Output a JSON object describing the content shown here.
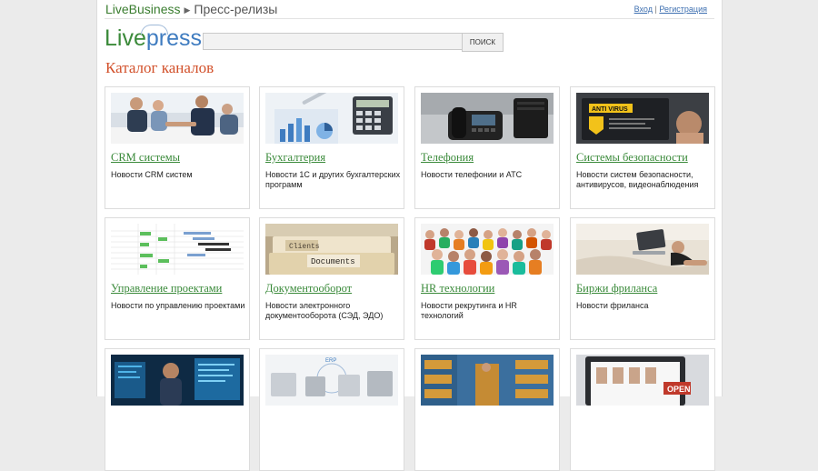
{
  "header": {
    "brand": "LiveBusiness",
    "section": "Пресс-релизы",
    "login": "Вход",
    "separator": "|",
    "register": "Регистрация"
  },
  "logo": {
    "part1": "Live",
    "part2": "press"
  },
  "search": {
    "button_label": "ПОИСК",
    "value": ""
  },
  "catalog_title": "Каталог каналов",
  "channels": [
    {
      "title": "CRM системы",
      "desc": "Новости CRM систем"
    },
    {
      "title": "Бухгалтерия",
      "desc": "Новости 1С и других бухгалтерских программ"
    },
    {
      "title": "Телефония",
      "desc": "Новости телефонии и АТС"
    },
    {
      "title": "Системы безопасности",
      "desc": "Новости систем безопасности, антивирусов, видеонаблюдения"
    },
    {
      "title": "Управление проектами",
      "desc": "Новости по управлению проектами"
    },
    {
      "title": "Документооборот",
      "desc": "Новости электронного документооборота (СЭД, ЭДО)"
    },
    {
      "title": "HR технологии",
      "desc": "Новости рекрутинга и HR технологий"
    },
    {
      "title": "Биржи фриланса",
      "desc": "Новости фриланса"
    }
  ],
  "image_text": {
    "antivirus": "ANTI VIRUS",
    "clients": "Clients",
    "documents": "Documents",
    "erp": "ERP",
    "open": "OPEN"
  }
}
